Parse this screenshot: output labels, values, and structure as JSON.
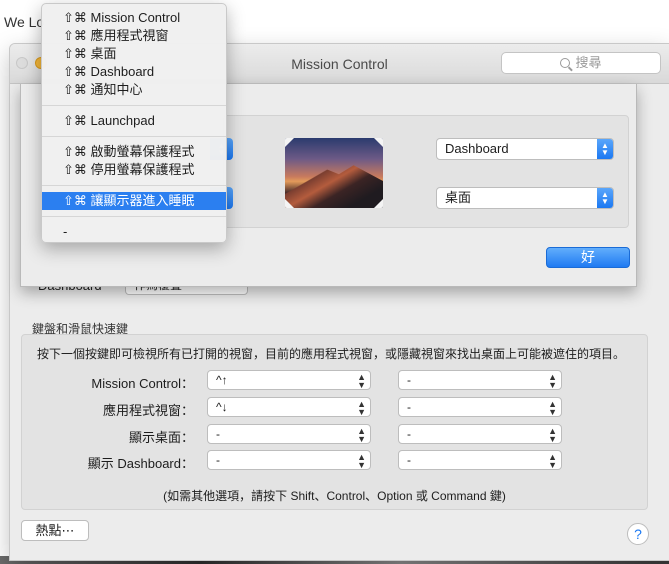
{
  "background_window": {
    "title_fragment": "We Lo"
  },
  "window": {
    "title": "Mission Control",
    "search_placeholder": "搜尋"
  },
  "sheet": {
    "top_right_corner": "Dashboard",
    "bottom_right_corner": "桌面",
    "ok_label": "好"
  },
  "underlying": {
    "dashboard_label": "Dashboard",
    "dashboard_value": "作為覆疊"
  },
  "keyboard": {
    "section_label": "鍵盤和滑鼠快速鍵",
    "description": "按下一個按鍵即可檢視所有已打開的視窗，目前的應用程式視窗，或隱藏視窗來找出桌面上可能被遮住的項目。",
    "rows": [
      {
        "label": "Mission Control：",
        "key": "^↑",
        "mouse": "-"
      },
      {
        "label": "應用程式視窗：",
        "key": "^↓",
        "mouse": "-"
      },
      {
        "label": "顯示桌面：",
        "key": "-",
        "mouse": "-"
      },
      {
        "label": "顯示 Dashboard：",
        "key": "-",
        "mouse": "-"
      }
    ],
    "note": "(如需其他選項，請按下 Shift、Control、Option 或 Command 鍵)"
  },
  "buttons": {
    "hot_corners": "熱點⋯",
    "help": "?"
  },
  "menu": {
    "items": [
      "⇧⌘ Mission Control",
      "⇧⌘ 應用程式視窗",
      "⇧⌘ 桌面",
      "⇧⌘ Dashboard",
      "⇧⌘ 通知中心",
      "⇧⌘ Launchpad",
      "⇧⌘ 啟動螢幕保護程式",
      "⇧⌘ 停用螢幕保護程式",
      "⇧⌘ 讓顯示器進入睡眠",
      "-"
    ],
    "selected_index": 8
  },
  "colors": {
    "accent": "#1b78f2",
    "selection": "#2b7ff0"
  }
}
